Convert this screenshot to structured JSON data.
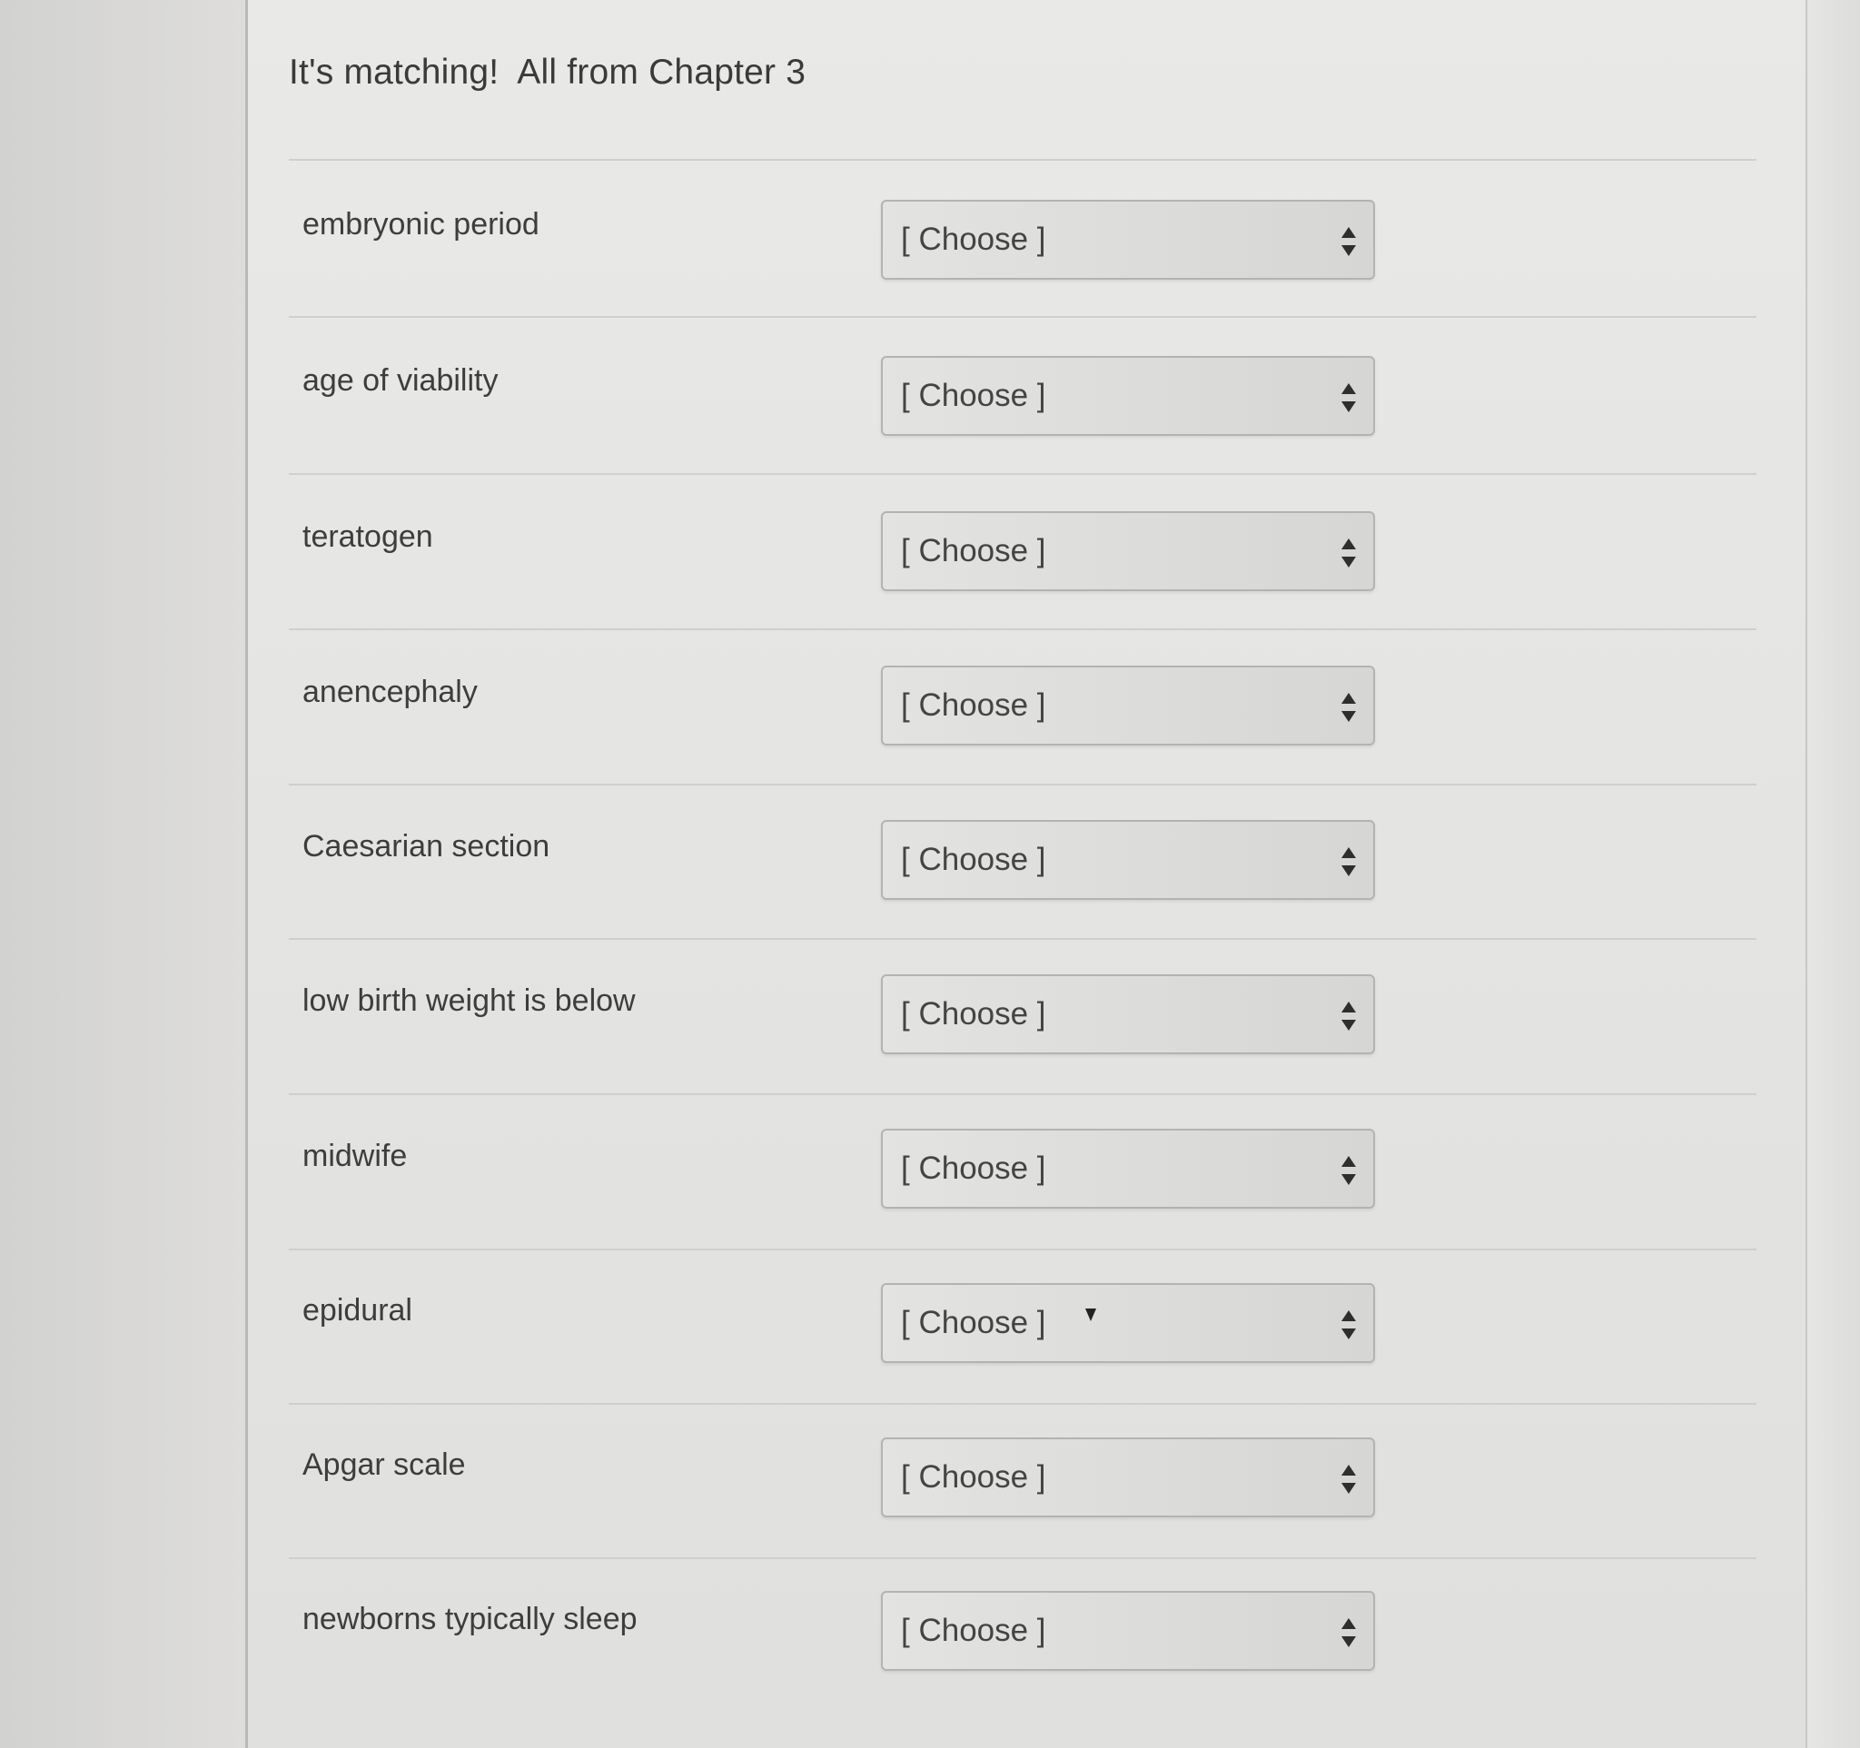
{
  "quiz": {
    "title": "It's matching!  All from Chapter 3"
  },
  "questions": [
    {
      "term": "embryonic period",
      "select_value": "[ Choose ]"
    },
    {
      "term": "age of viability",
      "select_value": "[ Choose ]"
    },
    {
      "term": "teratogen",
      "select_value": "[ Choose ]"
    },
    {
      "term": "anencephaly",
      "select_value": "[ Choose ]"
    },
    {
      "term": "Caesarian section",
      "select_value": "[ Choose ]"
    },
    {
      "term": "low birth weight is below",
      "select_value": "[ Choose ]"
    },
    {
      "term": "midwife",
      "select_value": "[ Choose ]"
    },
    {
      "term": "epidural",
      "select_value": "[ Choose ]"
    },
    {
      "term": "Apgar scale",
      "select_value": "[ Choose ]"
    },
    {
      "term": "newborns typically sleep",
      "select_value": "[ Choose ]"
    }
  ],
  "icons": {
    "select_arrows": "up-down-chevron-icon",
    "cursor": "mouse-cursor-icon"
  },
  "colors": {
    "panel_background": "#e6e6e4",
    "text": "#3d3d3d",
    "select_background": "#dcdcda",
    "select_border": "#b3b3b1"
  }
}
